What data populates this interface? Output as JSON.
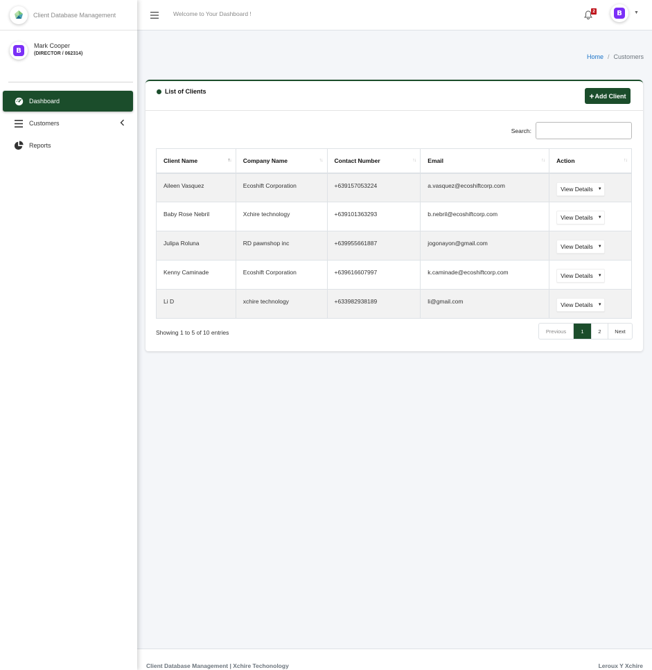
{
  "app": {
    "brand_name": "Client Database Management",
    "welcome_text": "Welcome to Your Dashboard !",
    "notification_count": "2",
    "avatar_letter": "B"
  },
  "user": {
    "name": "Mark Cooper",
    "role": "(DIRECTOR / 062314)"
  },
  "sidebar": {
    "items": [
      {
        "label": "Dashboard",
        "icon": "gauge-icon",
        "active": true
      },
      {
        "label": "Customers",
        "icon": "bars-icon",
        "active": false
      },
      {
        "label": "Reports",
        "icon": "pie-chart-icon",
        "active": false
      }
    ]
  },
  "breadcrumb": {
    "home": "Home",
    "separator": "/",
    "current": "Customers"
  },
  "card": {
    "title": "List of Clients",
    "add_button": "Add Client",
    "search_label": "Search:",
    "search_value": ""
  },
  "table": {
    "columns": [
      "Client Name",
      "Company Name",
      "Contact Number",
      "Email",
      "Action"
    ],
    "rows": [
      {
        "client": "Aileen Vasquez",
        "company": "Ecoshift Corporation",
        "contact": "+639157053224",
        "email": "a.vasquez@ecoshiftcorp.com",
        "action": "View Details"
      },
      {
        "client": "Baby Rose Nebril",
        "company": "Xchire technology",
        "contact": "+639101363293",
        "email": "b.nebril@ecoshiftcorp.com",
        "action": "View Details"
      },
      {
        "client": "Julipa Roluna",
        "company": "RD pawnshop inc",
        "contact": "+639955661887",
        "email": "jogonayon@gmail.com",
        "action": "View Details"
      },
      {
        "client": "Kenny Caminade",
        "company": "Ecoshift Corporation",
        "contact": "+639616607997",
        "email": "k.caminade@ecoshiftcorp.com",
        "action": "View Details"
      },
      {
        "client": "Li D",
        "company": "xchire technology",
        "contact": "+633982938189",
        "email": "li@gmail.com",
        "action": "View Details"
      }
    ]
  },
  "pagination": {
    "info": "Showing 1 to 5 of 10 entries",
    "previous": "Previous",
    "pages": [
      "1",
      "2"
    ],
    "current_page": "1",
    "next": "Next"
  },
  "footer": {
    "left": "Client Database Management | Xchire Techonology",
    "right": "Leroux Y Xchire"
  },
  "colors": {
    "accent": "#1b4d2b",
    "badge": "#c0161e",
    "avatar": "#7b2ff7",
    "link": "#1a73c8"
  }
}
